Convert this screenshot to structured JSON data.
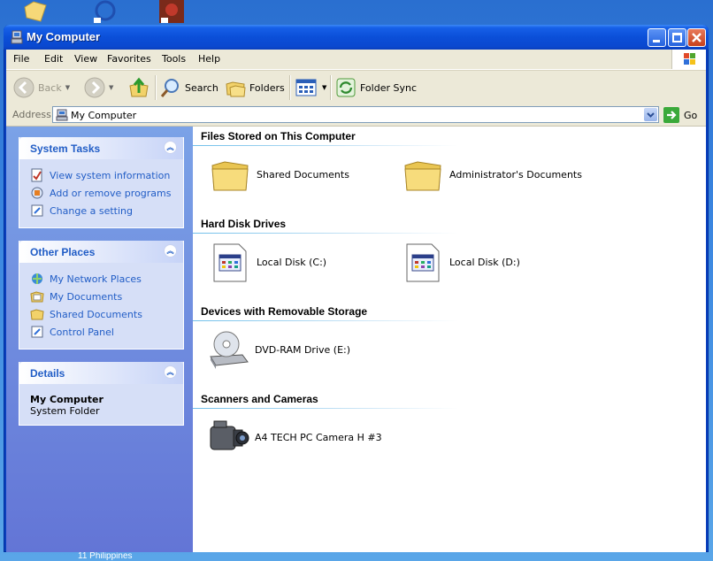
{
  "desktop": {
    "caption": "11 Philippines"
  },
  "window": {
    "title": "My Computer"
  },
  "menu": [
    "File",
    "Edit",
    "View",
    "Favorites",
    "Tools",
    "Help"
  ],
  "toolbar": {
    "back": "Back",
    "search": "Search",
    "folders": "Folders",
    "folder_sync": "Folder Sync"
  },
  "address": {
    "label": "Address",
    "value": "My Computer",
    "go": "Go"
  },
  "sidebar": {
    "system_tasks": {
      "title": "System Tasks",
      "items": [
        "View system information",
        "Add or remove programs",
        "Change a setting"
      ]
    },
    "other_places": {
      "title": "Other Places",
      "items": [
        "My Network Places",
        "My Documents",
        "Shared Documents",
        "Control Panel"
      ]
    },
    "details": {
      "title": "Details",
      "name": "My Computer",
      "type": "System Folder"
    }
  },
  "groups": {
    "files": {
      "title": "Files Stored on This Computer",
      "items": [
        "Shared Documents",
        "Administrator's Documents"
      ]
    },
    "hdd": {
      "title": "Hard Disk Drives",
      "items": [
        "Local Disk (C:)",
        "Local Disk (D:)"
      ]
    },
    "removable": {
      "title": "Devices with Removable Storage",
      "items": [
        "DVD-RAM Drive (E:)"
      ]
    },
    "scanners": {
      "title": "Scanners and Cameras",
      "items": [
        "A4 TECH PC Camera H #3"
      ]
    }
  }
}
